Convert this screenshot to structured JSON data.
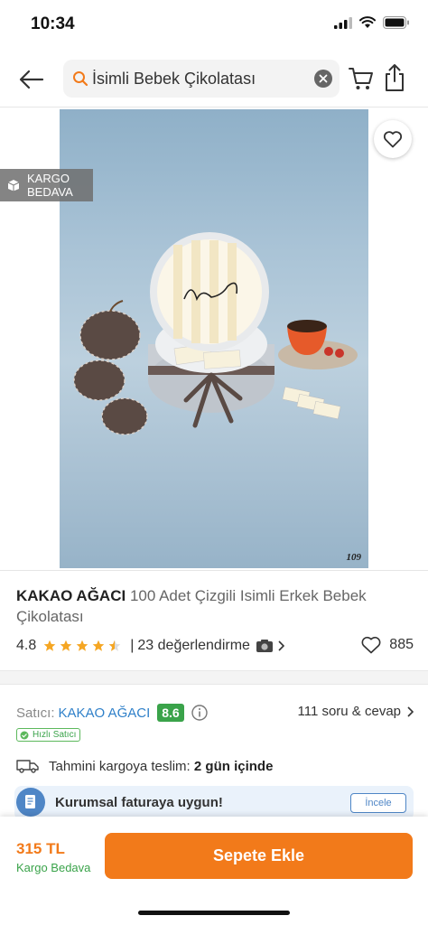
{
  "status_bar": {
    "time": "10:34"
  },
  "search": {
    "query": "İsimli Bebek Çikolatası"
  },
  "product": {
    "image_badge": {
      "line1": "KARGO",
      "line2": "BEDAVA"
    },
    "image_number": "109",
    "brand": "KAKAO AĞACI",
    "title": "100 Adet Çizgili Isimli Erkek Bebek Çikolatası",
    "rating": "4.8",
    "stars": 4.5,
    "separator": "|",
    "review_count": "23 değerlendirme",
    "favorite_count": "885"
  },
  "seller": {
    "label": "Satıcı:",
    "name": "KAKAO AĞACI",
    "score": "8.6",
    "qa_link": "111 soru & cevap",
    "fast_badge": "Hızlı Satıcı"
  },
  "delivery": {
    "label": "Tahmini kargoya teslim:",
    "value": "2 gün içinde"
  },
  "invoice": {
    "text": "Kurumsal faturaya uygun!",
    "button": "İncele"
  },
  "bottom_bar": {
    "price": "315 TL",
    "shipping": "Kargo Bedava",
    "add_to_cart": "Sepete Ekle"
  },
  "colors": {
    "accent": "#f27a1a",
    "seller_link": "#2f80c9",
    "score_green": "#3aa34a",
    "star": "#f5a623"
  },
  "icons": [
    "back-arrow-icon",
    "search-icon",
    "clear-icon",
    "cart-icon",
    "share-icon",
    "heart-icon",
    "box-icon",
    "star-icon",
    "camera-icon",
    "chevron-right-icon",
    "info-icon",
    "truck-icon",
    "invoice-icon"
  ]
}
